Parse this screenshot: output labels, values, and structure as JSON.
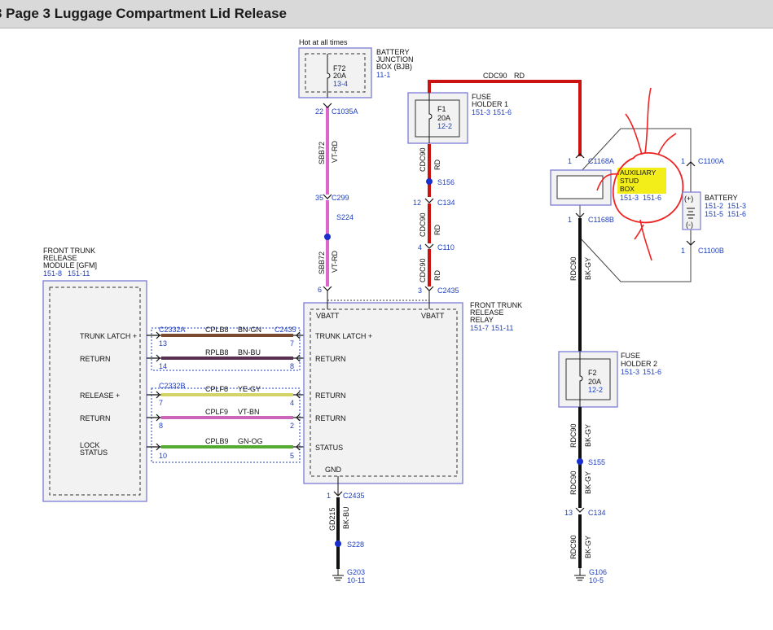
{
  "header": {
    "title": "3 Page 3 Luggage Compartment Lid Release"
  },
  "colors": {
    "box_border": "#7b7bd6",
    "box_fill": "#f2f2f2",
    "ref_text": "#1f3fbf",
    "wire_rd": "#cc1111",
    "wire_vt_rd": "#dd66cc",
    "wire_bk": "#111111",
    "wire_bn_gn": "#7a4a30",
    "wire_bn_bu": "#5a3050",
    "wire_ye_gy": "#d4d466",
    "wire_vt_bn": "#cc66bb",
    "wire_gn_og": "#55aa33",
    "splice_dot": "#1a2ecc",
    "annotation": "#ee2222",
    "highlight": "#f3ee1a"
  },
  "bjb": {
    "hot_label": "Hot at all times",
    "name_lines": [
      "BATTERY",
      "JUNCTION",
      "BOX (BJB)"
    ],
    "ref": "11-1",
    "fuse": {
      "name": "F72",
      "rating": "20A",
      "ref": "13-4"
    }
  },
  "fuse_holder_1": {
    "name_lines": [
      "FUSE",
      "HOLDER 1"
    ],
    "refs": [
      "151-3",
      "151-6"
    ],
    "fuse": {
      "name": "F1",
      "rating": "20A",
      "ref": "12-2"
    }
  },
  "fuse_holder_2": {
    "name_lines": [
      "FUSE",
      "HOLDER 2"
    ],
    "refs": [
      "151-3",
      "151-6"
    ],
    "fuse": {
      "name": "F2",
      "rating": "20A",
      "ref": "12-2"
    }
  },
  "top_wire": {
    "circuit": "CDC90",
    "color": "RD"
  },
  "aux_stud": {
    "name_lines": [
      "AUXILIARY",
      "STUD",
      "BOX"
    ],
    "refs": [
      "151-3",
      "151-6"
    ],
    "top_pin": "1",
    "top_conn": "C1168A",
    "bot_pin": "1",
    "bot_conn": "C1168B"
  },
  "battery": {
    "name": "BATTERY",
    "refs": [
      "151-2",
      "151-3",
      "151-5",
      "151-6"
    ],
    "plus": "(+)",
    "minus": "(-)",
    "top_pin": "1",
    "top_conn": "C1100A",
    "bot_pin": "1",
    "bot_conn": "C1100B"
  },
  "module": {
    "name_lines": [
      "FRONT TRUNK",
      "RELEASE",
      "MODULE [GFM]"
    ],
    "refs": [
      "151-8",
      "151-11"
    ],
    "pins": [
      {
        "label": "TRUNK LATCH +",
        "pin": "13"
      },
      {
        "label": "RETURN",
        "pin": "14"
      },
      {
        "label": "RELEASE +",
        "pin": "7"
      },
      {
        "label": "RETURN",
        "pin": "8"
      },
      {
        "label_lines": [
          "LOCK",
          "STATUS"
        ],
        "pin": "10"
      }
    ],
    "conn_a": "C2332A",
    "conn_b": "C2332B"
  },
  "relay": {
    "name_lines": [
      "FRONT TRUNK",
      "RELEASE",
      "RELAY"
    ],
    "refs": [
      "151-7",
      "151-11"
    ],
    "vbatt_left": "VBATT",
    "vbatt_right": "VBATT",
    "gnd": "GND",
    "conn": "C2435",
    "pins": [
      {
        "label": "TRUNK LATCH +",
        "pin": "7"
      },
      {
        "label": "RETURN",
        "pin": "8"
      },
      {
        "label": "RETURN",
        "pin": "4"
      },
      {
        "label": "RETURN",
        "pin": "2"
      },
      {
        "label": "STATUS",
        "pin": "5"
      }
    ]
  },
  "harness_wires": [
    {
      "circuit": "CPLB8",
      "color": "BN-GN"
    },
    {
      "circuit": "RPLB8",
      "color": "BN-BU"
    },
    {
      "circuit": "CPLF8",
      "color": "YE-GY"
    },
    {
      "circuit": "CPLF9",
      "color": "VT-BN"
    },
    {
      "circuit": "CPLB9",
      "color": "GN-OG"
    }
  ],
  "left_branch": {
    "conn1_pin": "22",
    "conn1": "C1035A",
    "seg1_circuit": "SBB72",
    "seg1_color": "VT-RD",
    "conn2_pin": "35",
    "conn2": "C299",
    "splice": "S224",
    "seg2_circuit": "SBB72",
    "seg2_color": "VT-RD",
    "relay_pin": "6"
  },
  "mid_branch": {
    "seg1_circuit": "CDC90",
    "seg1_color": "RD",
    "splice": "S156",
    "conn_c134_pin": "12",
    "conn_c134": "C134",
    "seg2_circuit": "CDC90",
    "seg2_color": "RD",
    "conn_c110_pin": "4",
    "conn_c110": "C110",
    "seg3_circuit": "CDC90",
    "seg3_color": "RD",
    "relay_pin": "3",
    "relay_conn": "C2435"
  },
  "ground_branch": {
    "pin": "1",
    "conn": "C2435",
    "circuit": "GD215",
    "color": "BK-BU",
    "splice": "S228",
    "ground": "G203",
    "ground_ref": "10-11"
  },
  "right_branch": {
    "seg1_circuit": "RDC90",
    "seg1_color": "BK-GY",
    "seg2_circuit": "RDC90",
    "seg2_color": "BK-GY",
    "splice": "S155",
    "seg3_circuit": "RDC90",
    "seg3_color": "BK-GY",
    "conn_pin": "13",
    "conn": "C134",
    "seg4_circuit": "RDC90",
    "seg4_color": "BK-GY",
    "ground": "G106",
    "ground_ref": "10-5"
  }
}
